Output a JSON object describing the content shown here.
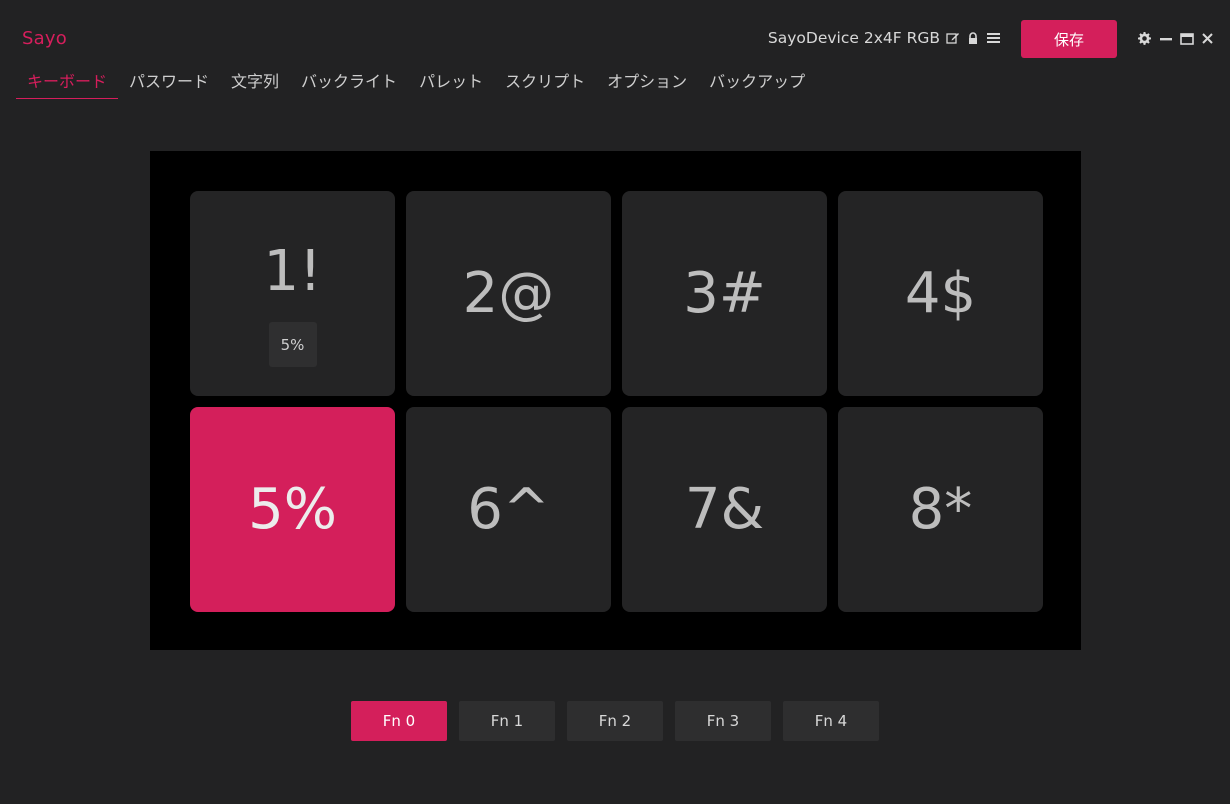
{
  "app": {
    "brand": "Sayo",
    "device_name": "SayoDevice 2x4F RGB",
    "save_label": "保存"
  },
  "icons": {
    "edit": "edit-icon",
    "lock": "lock-icon",
    "menu": "menu-icon",
    "settings": "gear-icon",
    "minimize": "minimize-icon",
    "maximize": "maximize-icon",
    "close": "close-icon"
  },
  "tabs": [
    {
      "label": "キーボード",
      "active": true
    },
    {
      "label": "パスワード",
      "active": false
    },
    {
      "label": "文字列",
      "active": false
    },
    {
      "label": "バックライト",
      "active": false
    },
    {
      "label": "パレット",
      "active": false
    },
    {
      "label": "スクリプト",
      "active": false
    },
    {
      "label": "オプション",
      "active": false
    },
    {
      "label": "バックアップ",
      "active": false
    }
  ],
  "keys": [
    {
      "label": "1!",
      "sub": "5%",
      "active": false
    },
    {
      "label": "2@",
      "sub": "",
      "active": false
    },
    {
      "label": "3#",
      "sub": "",
      "active": false
    },
    {
      "label": "4$",
      "sub": "",
      "active": false
    },
    {
      "label": "5%",
      "sub": "",
      "active": true
    },
    {
      "label": "6^",
      "sub": "",
      "active": false
    },
    {
      "label": "7&",
      "sub": "",
      "active": false
    },
    {
      "label": "8*",
      "sub": "",
      "active": false
    }
  ],
  "fn_layers": [
    {
      "label": "Fn 0",
      "active": true
    },
    {
      "label": "Fn 1",
      "active": false
    },
    {
      "label": "Fn 2",
      "active": false
    },
    {
      "label": "Fn 3",
      "active": false
    },
    {
      "label": "Fn 4",
      "active": false
    }
  ],
  "colors": {
    "accent": "#d41f5b",
    "background": "#222223",
    "panel": "#000000",
    "key": "#242425"
  }
}
